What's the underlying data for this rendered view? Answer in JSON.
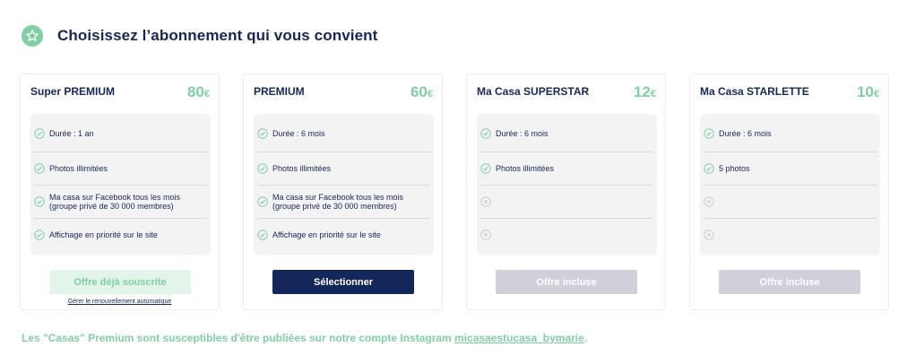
{
  "header": {
    "title": "Choisissez l’abonnement qui vous convient",
    "icon": "star-icon",
    "accent_color": "#7fcfa4",
    "text_color": "#14275a"
  },
  "plans": [
    {
      "name": "Super PREMIUM",
      "price": "80",
      "currency": "€",
      "features": [
        {
          "text": "Durée : 1 an",
          "included": true
        },
        {
          "text": "Photos illimitées",
          "included": true
        },
        {
          "text": "Ma casa sur Facebook tous les mois (groupe privé de 30 000 membres)",
          "included": true
        },
        {
          "text": "Affichage en priorité sur le site",
          "included": true
        }
      ],
      "button_label": "Offre déjà souscrite",
      "link_label": "Gérer le renouvellement automatique"
    },
    {
      "name": "PREMIUM",
      "price": "60",
      "currency": "€",
      "features": [
        {
          "text": "Durée : 6 mois",
          "included": true
        },
        {
          "text": "Photos illimitées",
          "included": true
        },
        {
          "text": "Ma casa sur Facebook tous les mois (groupe privé de 30 000 membres)",
          "included": true
        },
        {
          "text": "Affichage en priorité sur le site",
          "included": true
        }
      ],
      "button_label": "Sélectionner"
    },
    {
      "name": "Ma Casa SUPERSTAR",
      "price": "12",
      "currency": "€",
      "features": [
        {
          "text": "Durée : 6 mois",
          "included": true
        },
        {
          "text": "Photos illimitées",
          "included": true
        },
        {
          "text": "",
          "included": false
        },
        {
          "text": "",
          "included": false
        }
      ],
      "button_label": "Offre incluse"
    },
    {
      "name": "Ma Casa STARLETTE",
      "price": "10",
      "currency": "€",
      "features": [
        {
          "text": "Durée : 6 mois",
          "included": true
        },
        {
          "text": "5 photos",
          "included": true
        },
        {
          "text": "",
          "included": false
        },
        {
          "text": "",
          "included": false
        }
      ],
      "button_label": "Offre incluse"
    }
  ],
  "footer": {
    "text": "Les \"Casas\" Premium sont susceptibles d'être publiées sur notre compte Instagram ",
    "link_text": "micasaestucasa_bymarie",
    "suffix": "."
  }
}
